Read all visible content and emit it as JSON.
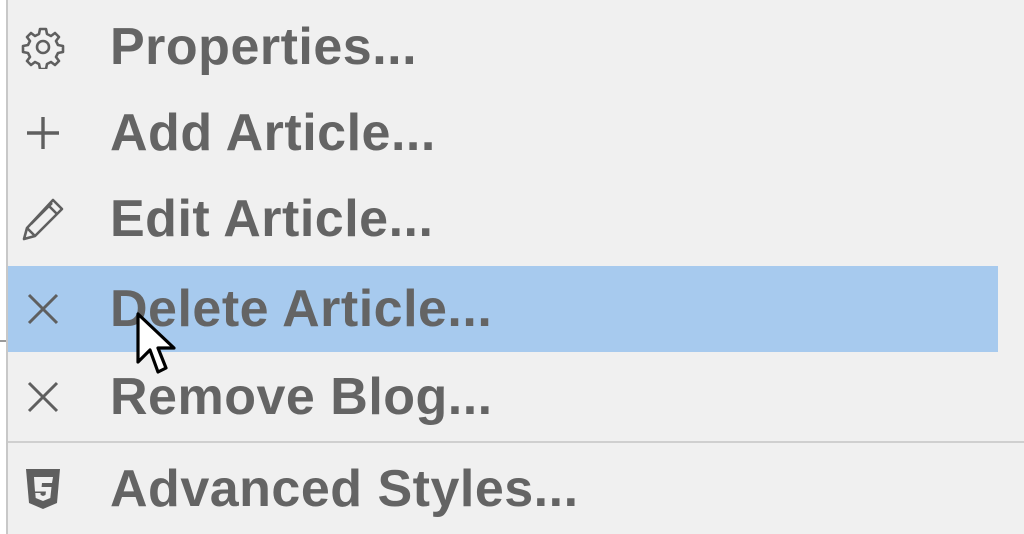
{
  "menu": {
    "items": [
      {
        "label": "Properties...",
        "icon": "gear-icon"
      },
      {
        "label": "Add Article...",
        "icon": "plus-icon"
      },
      {
        "label": "Edit Article...",
        "icon": "pencil-icon"
      },
      {
        "label": "Delete Article...",
        "icon": "close-icon",
        "highlighted": true
      },
      {
        "label": "Remove Blog...",
        "icon": "close-icon"
      },
      {
        "label": "Advanced Styles...",
        "icon": "css3-icon"
      }
    ]
  },
  "colors": {
    "menu_background": "#f0f0f0",
    "highlight": "#a7caee",
    "text": "#646464",
    "separator": "#cfcfcf"
  }
}
